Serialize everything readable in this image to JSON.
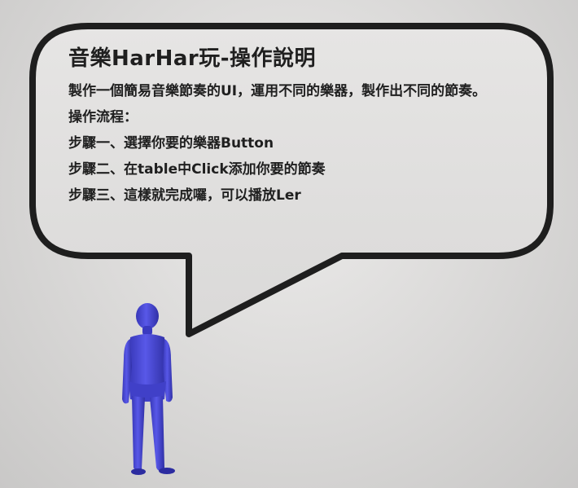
{
  "bubble": {
    "title": "音樂HarHar玩-操作說明",
    "description": "製作一個簡易音樂節奏的UI，運用不同的樂器，製作出不同的節奏。",
    "flow_title": "操作流程：",
    "steps": [
      "步驟一、選擇你要的樂器Button",
      "步驟二、在table中Click添加你要的節奏",
      "步驟三、這樣就完成囉，可以播放Ler"
    ]
  },
  "colors": {
    "bubble_stroke": "#1e1e1e",
    "avatar": "#4a4ad8",
    "background": "#e3e2e1",
    "text": "#1f1f1f"
  },
  "icons": {
    "avatar": "person-avatar-icon"
  }
}
